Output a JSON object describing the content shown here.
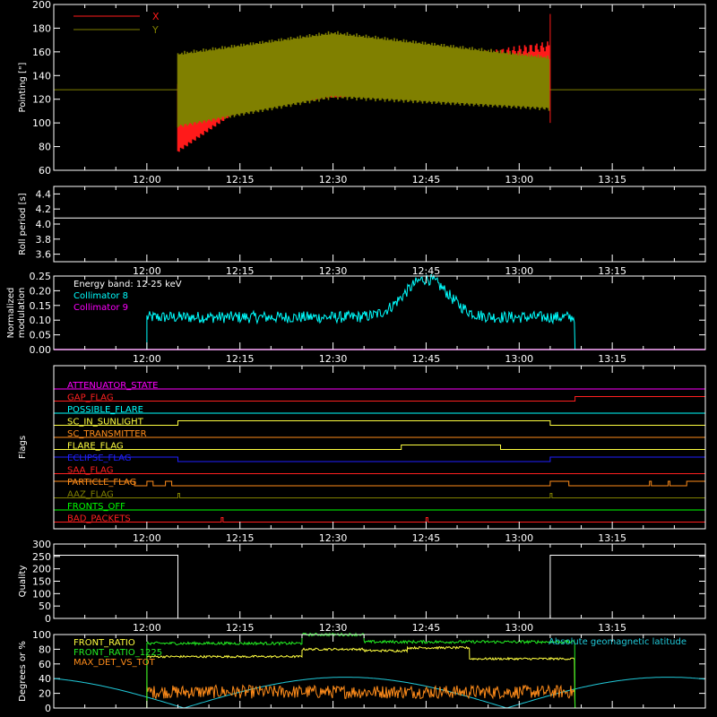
{
  "colors": {
    "frame": "#ffffff",
    "x_pointing": "#ff1a1a",
    "y_pointing": "#808000",
    "collimator8": "#00ffff",
    "collimator9": "#ff00ff",
    "front_ratio": "#ffff40",
    "front_ratio_1225": "#22ee22",
    "max_det": "#ff8c1a",
    "geomag": "#20c8d8"
  },
  "chart_data": [
    {
      "type": "line",
      "ylabel": "Pointing [\"]",
      "ylim": [
        60,
        200
      ],
      "xlim": [
        "11:45",
        "13:30"
      ],
      "x_ticks": [
        "12:00",
        "12:15",
        "12:30",
        "12:45",
        "13:00",
        "13:15"
      ],
      "y_ticks": [
        60,
        80,
        100,
        120,
        140,
        160,
        180,
        200
      ],
      "legend": "top-left",
      "series": [
        {
          "name": "X",
          "description_values": {
            "start": "12:05",
            "end": "13:05",
            "upper_envelope": [
              [
                12.08,
                135
              ],
              [
                12.5,
                135
              ],
              [
                12.75,
                150
              ],
              [
                13.08,
                165
              ]
            ],
            "lower_envelope": [
              [
                12.08,
                78
              ],
              [
                12.25,
                115
              ],
              [
                12.5,
                125
              ],
              [
                13.08,
                132
              ]
            ]
          }
        },
        {
          "name": "Y",
          "description_values": {
            "start": "12:05",
            "end": "13:05",
            "upper_envelope": [
              [
                12.08,
                160
              ],
              [
                12.5,
                178
              ],
              [
                13.08,
                157
              ]
            ],
            "lower_envelope": [
              [
                12.08,
                95
              ],
              [
                12.5,
                120
              ],
              [
                13.08,
                110
              ]
            ],
            "flat_level": 128
          }
        }
      ]
    },
    {
      "type": "line",
      "ylabel": "Roll period [s]",
      "ylim": [
        3.5,
        4.5
      ],
      "y_ticks": [
        3.6,
        3.8,
        4.0,
        4.2,
        4.4
      ],
      "x_ticks": [
        "12:00",
        "12:15",
        "12:30",
        "12:45",
        "13:00",
        "13:15"
      ],
      "series": [
        {
          "name": "",
          "constant": 4.08
        }
      ]
    },
    {
      "type": "line",
      "ylabel": "Normalized modulation",
      "ylim": [
        0.0,
        0.25
      ],
      "y_ticks": [
        0.0,
        0.05,
        0.1,
        0.15,
        0.2,
        0.25
      ],
      "x_ticks": [
        "12:00",
        "12:15",
        "12:30",
        "12:45",
        "13:00",
        "13:15"
      ],
      "annotation": "Energy band: 12-25 keV",
      "legend": "top-left",
      "series": [
        {
          "name": "Collimator 8",
          "start": "12:00",
          "end": "13:09",
          "baseline": 0.11,
          "peak_time": "12:45",
          "peak_value": 0.24
        },
        {
          "name": "Collimator 9",
          "constant": 0.0
        }
      ]
    },
    {
      "type": "line",
      "ylabel": "Flags",
      "x_ticks": [
        "12:00",
        "12:15",
        "12:30",
        "12:45",
        "13:00",
        "13:15"
      ],
      "flags": [
        {
          "label": "ATTENUATOR_STATE",
          "color": "#ff00ff",
          "high": []
        },
        {
          "label": "GAP_FLAG",
          "color": "#ff2020",
          "high": [
            [
              "13:09",
              "13:30"
            ]
          ]
        },
        {
          "label": "POSSIBLE_FLARE",
          "color": "#00ffff",
          "high": []
        },
        {
          "label": "SC_IN_SUNLIGHT",
          "color": "#ffff40",
          "high": [
            [
              "12:05",
              "13:05"
            ]
          ]
        },
        {
          "label": "SC_TRANSMITTER",
          "color": "#ff8c1a",
          "high": []
        },
        {
          "label": "FLARE_FLAG",
          "color": "#ffff40",
          "high": [
            [
              "12:41",
              "12:57"
            ]
          ]
        },
        {
          "label": "ECLIPSE_FLAG",
          "color": "#2020ff",
          "high": [
            [
              "11:45",
              "12:05"
            ],
            [
              "13:05",
              "13:30"
            ]
          ]
        },
        {
          "label": "SAA_FLAG",
          "color": "#ff2020",
          "high": []
        },
        {
          "label": "PARTICLE_FLAG",
          "color": "#ff8c1a",
          "high": [
            [
              "11:45",
              "11:58"
            ],
            [
              "12:00",
              "12:01"
            ],
            [
              "12:03",
              "12:04"
            ],
            [
              "13:05",
              "13:08"
            ],
            [
              "13:21",
              "13:21"
            ],
            [
              "13:24",
              "13:24"
            ],
            [
              "13:27",
              "13:30"
            ]
          ]
        },
        {
          "label": "AAZ_FLAG",
          "color": "#808000",
          "high": [
            [
              "12:05",
              "12:05"
            ],
            [
              "13:05",
              "13:05"
            ]
          ]
        },
        {
          "label": "FRONTS_OFF",
          "color": "#00ff00",
          "high": []
        },
        {
          "label": "BAD_PACKETS",
          "color": "#ff2020",
          "high": [
            [
              "12:12",
              "12:12"
            ],
            [
              "12:45",
              "12:45"
            ]
          ]
        }
      ]
    },
    {
      "type": "line",
      "ylabel": "Quality",
      "ylim": [
        0,
        300
      ],
      "y_ticks": [
        0,
        50,
        100,
        150,
        200,
        250,
        300
      ],
      "x_ticks": [
        "12:00",
        "12:15",
        "12:30",
        "12:45",
        "13:00",
        "13:15"
      ],
      "series": [
        {
          "name": "",
          "high_value": 255,
          "high": [
            [
              "11:45",
              "12:05"
            ],
            [
              "13:05",
              "13:30"
            ]
          ]
        }
      ]
    },
    {
      "type": "line",
      "ylabel": "Degrees or %",
      "ylim": [
        0,
        100
      ],
      "y_ticks": [
        0,
        20,
        40,
        60,
        80,
        100
      ],
      "legend": "top-left",
      "series": [
        {
          "name": "FRONT_RATIO",
          "start": "12:00",
          "end": "13:09",
          "segments": [
            [
              "12:00",
              "12:25",
              70
            ],
            [
              "12:25",
              "12:35",
              80
            ],
            [
              "12:35",
              "12:42",
              78
            ],
            [
              "12:42",
              "12:52",
              82
            ],
            [
              "12:52",
              "13:09",
              67
            ]
          ]
        },
        {
          "name": "FRONT_RATIO_1225",
          "start": "12:00",
          "end": "13:09",
          "segments": [
            [
              "12:00",
              "12:25",
              88
            ],
            [
              "12:25",
              "12:35",
              100
            ],
            [
              "12:35",
              "13:09",
              90
            ]
          ]
        },
        {
          "name": "MAX_DET_VS_TOT",
          "start": "12:00",
          "end": "13:09",
          "level": 22
        },
        {
          "name": "Absolute geomagnetic latitude",
          "minima": [
            "12:06",
            "12:58"
          ],
          "maxima": [
            "12:32",
            "13:25"
          ],
          "max_value": 42,
          "start_value": 38
        }
      ]
    }
  ]
}
